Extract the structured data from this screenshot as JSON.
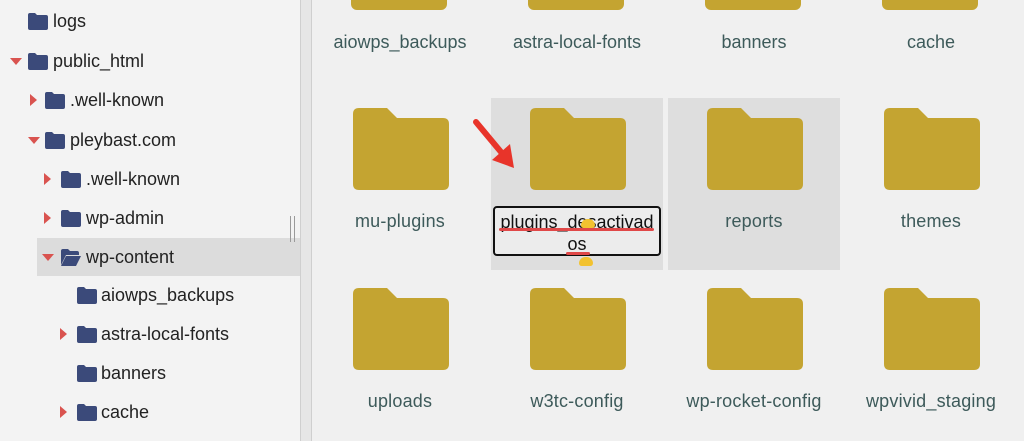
{
  "sidebar": {
    "items": [
      {
        "label": "logs",
        "caret": "none",
        "depth": 0
      },
      {
        "label": "public_html",
        "caret": "down",
        "depth": 0
      },
      {
        "label": ".well-known",
        "caret": "right",
        "depth": 1
      },
      {
        "label": "pleybast.com",
        "caret": "down",
        "depth": 1
      },
      {
        "label": ".well-known",
        "caret": "right",
        "depth": 2
      },
      {
        "label": "wp-admin",
        "caret": "right",
        "depth": 2
      },
      {
        "label": "wp-content",
        "caret": "down",
        "depth": 2,
        "selected": true,
        "open": true
      },
      {
        "label": "aiowps_backups",
        "caret": "none",
        "depth": 3
      },
      {
        "label": "astra-local-fonts",
        "caret": "right",
        "depth": 3
      },
      {
        "label": "banners",
        "caret": "none",
        "depth": 3
      },
      {
        "label": "cache",
        "caret": "right",
        "depth": 3
      }
    ]
  },
  "grid": {
    "top_row": [
      "aiowps_backups",
      "astra-local-fonts",
      "banners",
      "cache"
    ],
    "row2": [
      {
        "name": "mu-plugins",
        "highlight": false
      },
      {
        "name": "plugins_desactivados",
        "highlight": true,
        "renaming": true
      },
      {
        "name": "reports",
        "highlight": true
      },
      {
        "name": "themes",
        "highlight": false
      }
    ],
    "row3": [
      "uploads",
      "w3tc-config",
      "wp-rocket-config",
      "wpvivid_staging"
    ],
    "rename_text_line1": "plugins_desactivad",
    "rename_text_line2": "os"
  },
  "colors": {
    "folder": "#c4a431",
    "tree_folder": "#3b4a7a",
    "caret": "#d9534f",
    "label": "#3d5a5a",
    "arrow": "#e8342a"
  },
  "icons": {
    "tree_folder": "folder-icon",
    "tree_folder_open": "folder-open-icon",
    "grid_folder": "folder-icon",
    "annotation": "red-arrow-icon"
  }
}
